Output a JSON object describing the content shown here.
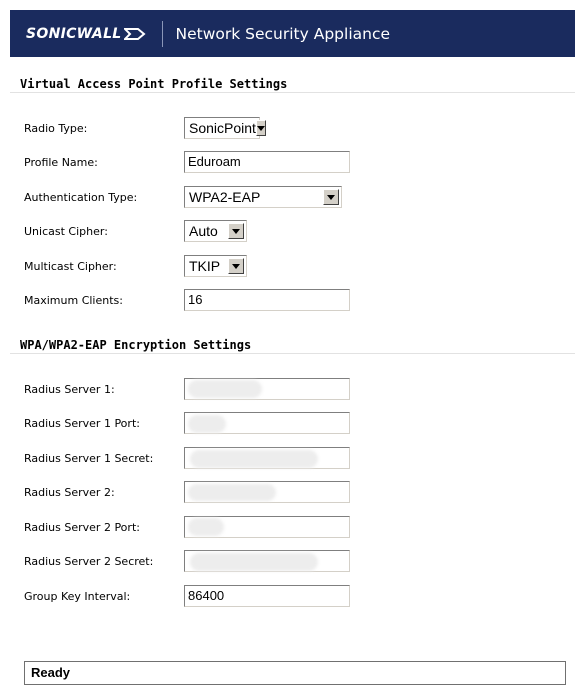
{
  "header": {
    "brand": "SONICWALL",
    "title": "Network Security Appliance",
    "colors": {
      "background": "#1a2b5e",
      "text": "#ffffff"
    }
  },
  "profile_section": {
    "heading": "Virtual Access Point Profile Settings",
    "fields": [
      {
        "label": "Radio Type:",
        "type": "select",
        "value": "SonicPoint"
      },
      {
        "label": "Profile Name:",
        "type": "text",
        "value": "Eduroam"
      },
      {
        "label": "Authentication Type:",
        "type": "select",
        "value": "WPA2-EAP"
      },
      {
        "label": "Unicast Cipher:",
        "type": "select",
        "value": "Auto"
      },
      {
        "label": "Multicast Cipher:",
        "type": "select",
        "value": "TKIP"
      },
      {
        "label": "Maximum Clients:",
        "type": "text",
        "value": "16"
      }
    ]
  },
  "encryption_section": {
    "heading": "WPA/WPA2-EAP Encryption Settings",
    "fields": [
      {
        "label": "Radius Server 1:",
        "type": "text",
        "value": "",
        "redacted": true
      },
      {
        "label": "Radius Server 1 Port:",
        "type": "text",
        "value": "",
        "redacted": true
      },
      {
        "label": "Radius Server 1 Secret:",
        "type": "text",
        "value": "",
        "redacted": true
      },
      {
        "label": "Radius Server 2:",
        "type": "text",
        "value": "",
        "redacted": true
      },
      {
        "label": "Radius Server 2 Port:",
        "type": "text",
        "value": "",
        "redacted": true
      },
      {
        "label": "Radius Server 2 Secret:",
        "type": "text",
        "value": "",
        "redacted": true
      },
      {
        "label": "Group Key Interval:",
        "type": "text",
        "value": "86400"
      }
    ]
  },
  "status_bar": {
    "text": "Ready"
  },
  "icons": {
    "dropdown": "chevron-down-icon",
    "logo_arrow": "sonicwall-arrow-icon"
  }
}
